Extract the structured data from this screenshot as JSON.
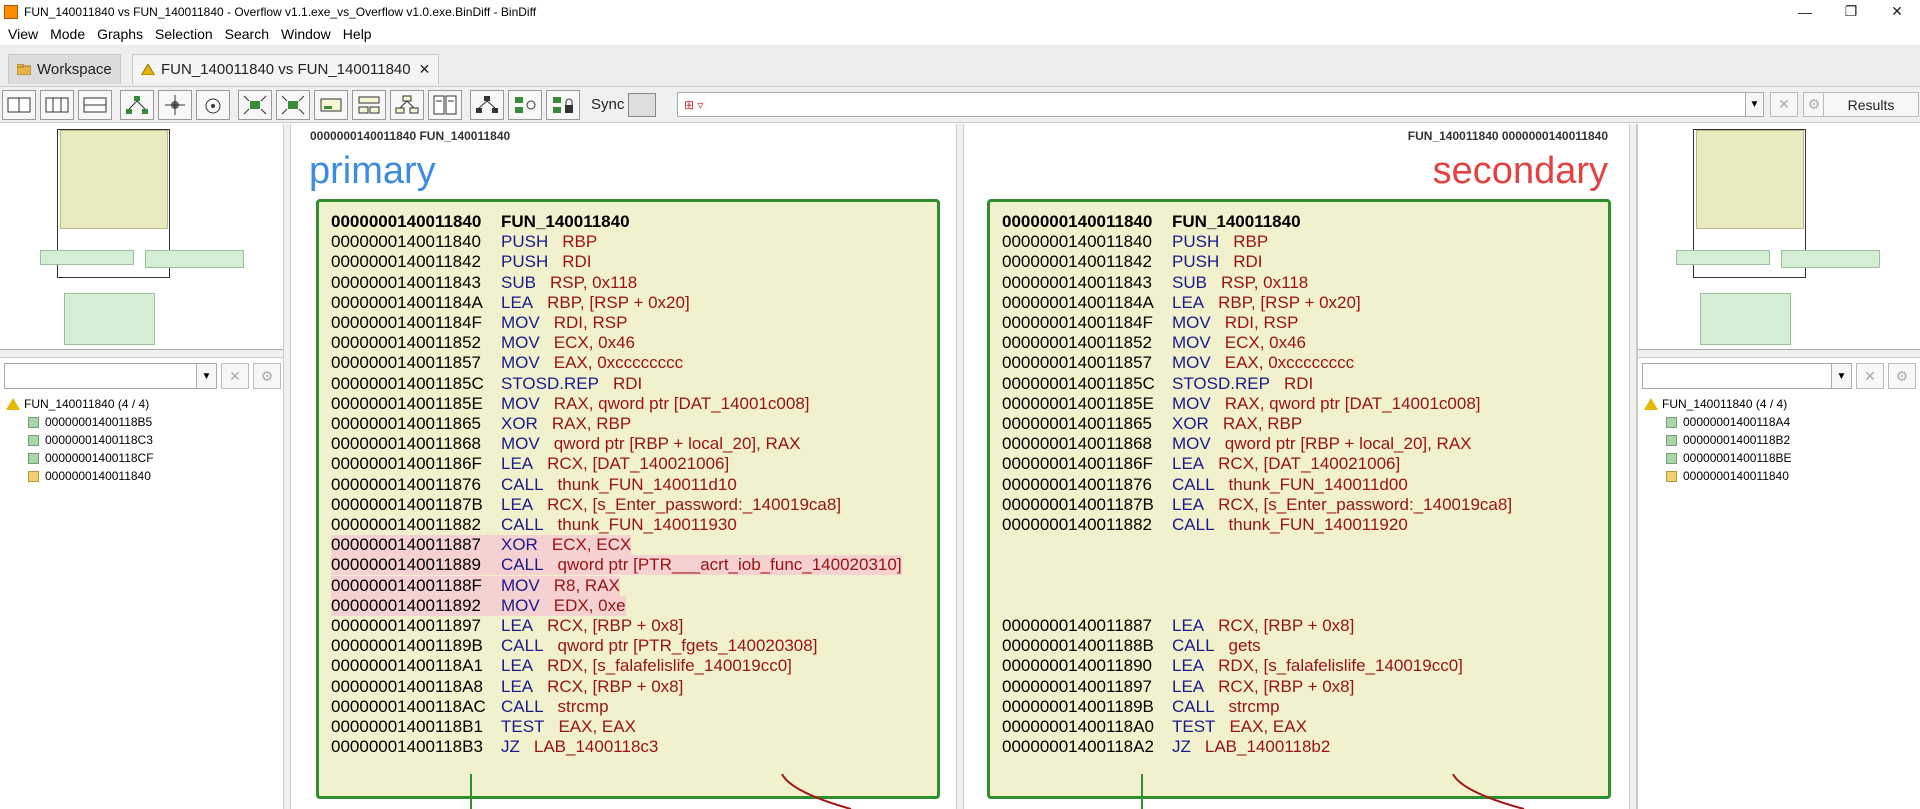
{
  "window": {
    "title": "FUN_140011840 vs FUN_140011840 - Overflow v1.1.exe_vs_Overflow v1.0.exe.BinDiff - BinDiff",
    "minimize": "—",
    "maximize": "❐",
    "close": "✕"
  },
  "menu": [
    "View",
    "Mode",
    "Graphs",
    "Selection",
    "Search",
    "Window",
    "Help"
  ],
  "tabs": {
    "workspace": "Workspace",
    "active": "FUN_140011840 vs FUN_140011840",
    "close": "✕"
  },
  "toolbar": {
    "sync_label": "Sync",
    "search_value": "",
    "clear": "✕",
    "settings": "⚙",
    "results": "Results"
  },
  "left_panel": {
    "tree_root": "FUN_140011840 (4 / 4)",
    "tree_items": [
      "00000001400118B5",
      "00000001400118C3",
      "00000001400118CF",
      "0000000140011840"
    ]
  },
  "right_panel": {
    "tree_root": "FUN_140011840 (4 / 4)",
    "tree_items": [
      "00000001400118A4",
      "00000001400118B2",
      "00000001400118BE",
      "0000000140011840"
    ]
  },
  "primary": {
    "header": "0000000140011840 FUN_140011840",
    "label": "primary",
    "head": {
      "addr": "0000000140011840",
      "name": "FUN_140011840"
    },
    "lines": [
      {
        "addr": "0000000140011840",
        "mn": "PUSH",
        "op": "RBP"
      },
      {
        "addr": "0000000140011842",
        "mn": "PUSH",
        "op": "RDI"
      },
      {
        "addr": "0000000140011843",
        "mn": "SUB",
        "op": "RSP, 0x118"
      },
      {
        "addr": "000000014001184A",
        "mn": "LEA",
        "op": "RBP, [RSP + 0x20]"
      },
      {
        "addr": "000000014001184F",
        "mn": "MOV",
        "op": "RDI, RSP"
      },
      {
        "addr": "0000000140011852",
        "mn": "MOV",
        "op": "ECX, 0x46"
      },
      {
        "addr": "0000000140011857",
        "mn": "MOV",
        "op": "EAX, 0xcccccccc"
      },
      {
        "addr": "000000014001185C",
        "mn": "STOSD.REP",
        "op": "RDI"
      },
      {
        "addr": "000000014001185E",
        "mn": "MOV",
        "op": "RAX, qword ptr [DAT_14001c008]"
      },
      {
        "addr": "0000000140011865",
        "mn": "XOR",
        "op": "RAX, RBP"
      },
      {
        "addr": "0000000140011868",
        "mn": "MOV",
        "op": "qword ptr [RBP + local_20], RAX"
      },
      {
        "addr": "000000014001186F",
        "mn": "LEA",
        "op": "RCX, [DAT_140021006]"
      },
      {
        "addr": "0000000140011876",
        "mn": "CALL",
        "op": "thunk_FUN_140011d10"
      },
      {
        "addr": "000000014001187B",
        "mn": "LEA",
        "op": "RCX, [s_Enter_password:_140019ca8]"
      },
      {
        "addr": "0000000140011882",
        "mn": "CALL",
        "op": "thunk_FUN_140011930"
      },
      {
        "addr": "0000000140011887",
        "mn": "XOR",
        "op": "ECX, ECX"
      },
      {
        "addr": "0000000140011889",
        "mn": "CALL",
        "op": "qword ptr [PTR___acrt_iob_func_140020310]"
      },
      {
        "addr": "000000014001188F",
        "mn": "MOV",
        "op": "R8, RAX"
      },
      {
        "addr": "0000000140011892",
        "mn": "MOV",
        "op": "EDX, 0xe"
      },
      {
        "addr": "0000000140011897",
        "mn": "LEA",
        "op": "RCX, [RBP + 0x8]"
      },
      {
        "addr": "000000014001189B",
        "mn": "CALL",
        "op": "qword ptr [PTR_fgets_140020308]"
      },
      {
        "addr": "00000001400118A1",
        "mn": "LEA",
        "op": "RDX, [s_falafelislife_140019cc0]"
      },
      {
        "addr": "00000001400118A8",
        "mn": "LEA",
        "op": "RCX, [RBP + 0x8]"
      },
      {
        "addr": "00000001400118AC",
        "mn": "CALL",
        "op": "strcmp"
      },
      {
        "addr": "00000001400118B1",
        "mn": "TEST",
        "op": "EAX, EAX"
      },
      {
        "addr": "00000001400118B3",
        "mn": "JZ",
        "op": "LAB_1400118c3"
      }
    ]
  },
  "secondary": {
    "header": "FUN_140011840 0000000140011840",
    "label": "secondary",
    "head": {
      "addr": "0000000140011840",
      "name": "FUN_140011840"
    },
    "lines": [
      {
        "addr": "0000000140011840",
        "mn": "PUSH",
        "op": "RBP"
      },
      {
        "addr": "0000000140011842",
        "mn": "PUSH",
        "op": "RDI"
      },
      {
        "addr": "0000000140011843",
        "mn": "SUB",
        "op": "RSP, 0x118"
      },
      {
        "addr": "000000014001184A",
        "mn": "LEA",
        "op": "RBP, [RSP + 0x20]"
      },
      {
        "addr": "000000014001184F",
        "mn": "MOV",
        "op": "RDI, RSP"
      },
      {
        "addr": "0000000140011852",
        "mn": "MOV",
        "op": "ECX, 0x46"
      },
      {
        "addr": "0000000140011857",
        "mn": "MOV",
        "op": "EAX, 0xcccccccc"
      },
      {
        "addr": "000000014001185C",
        "mn": "STOSD.REP",
        "op": "RDI"
      },
      {
        "addr": "000000014001185E",
        "mn": "MOV",
        "op": "RAX, qword ptr [DAT_14001c008]"
      },
      {
        "addr": "0000000140011865",
        "mn": "XOR",
        "op": "RAX, RBP"
      },
      {
        "addr": "0000000140011868",
        "mn": "MOV",
        "op": "qword ptr [RBP + local_20], RAX"
      },
      {
        "addr": "000000014001186F",
        "mn": "LEA",
        "op": "RCX, [DAT_140021006]"
      },
      {
        "addr": "0000000140011876",
        "mn": "CALL",
        "op": "thunk_FUN_140011d00"
      },
      {
        "addr": "000000014001187B",
        "mn": "LEA",
        "op": "RCX, [s_Enter_password:_140019ca8]"
      },
      {
        "addr": "0000000140011882",
        "mn": "CALL",
        "op": "thunk_FUN_140011920"
      },
      {
        "addr": "0000000140011887",
        "mn": "LEA",
        "op": "RCX, [RBP + 0x8]"
      },
      {
        "addr": "000000014001188B",
        "mn": "CALL",
        "op": "gets"
      },
      {
        "addr": "0000000140011890",
        "mn": "LEA",
        "op": "RDX, [s_falafelislife_140019cc0]"
      },
      {
        "addr": "0000000140011897",
        "mn": "LEA",
        "op": "RCX, [RBP + 0x8]"
      },
      {
        "addr": "000000014001189B",
        "mn": "CALL",
        "op": "strcmp"
      },
      {
        "addr": "00000001400118A0",
        "mn": "TEST",
        "op": "EAX, EAX"
      },
      {
        "addr": "00000001400118A2",
        "mn": "JZ",
        "op": "LAB_1400118b2"
      }
    ]
  }
}
